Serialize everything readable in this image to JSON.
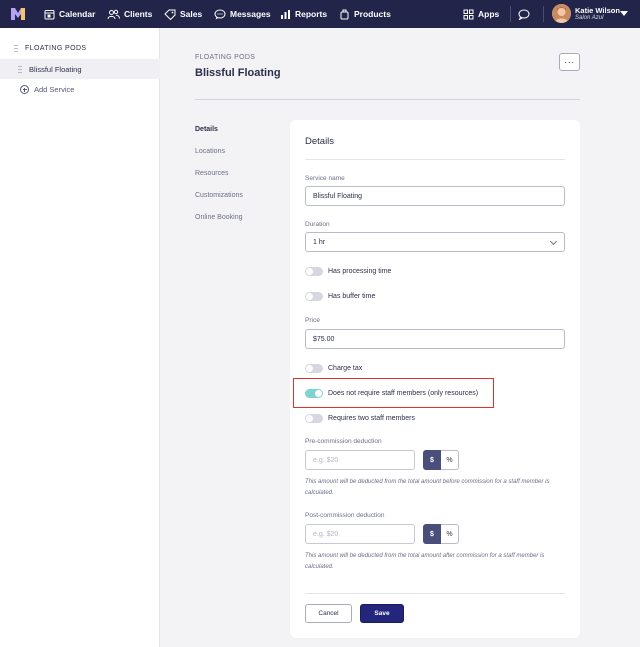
{
  "nav": {
    "items": [
      {
        "label": "Calendar",
        "icon": "calendar-icon"
      },
      {
        "label": "Clients",
        "icon": "clients-icon"
      },
      {
        "label": "Sales",
        "icon": "tag-icon"
      },
      {
        "label": "Messages",
        "icon": "messages-icon"
      },
      {
        "label": "Reports",
        "icon": "reports-icon"
      },
      {
        "label": "Products",
        "icon": "products-icon"
      }
    ],
    "apps_label": "Apps",
    "user_name": "Katie Wilson",
    "user_location": "Salon Azul",
    "bg_color": "#22244a"
  },
  "sidebar": {
    "heading": "FLOATING PODS",
    "active_item": "Blissful Floating",
    "add_label": "Add Service"
  },
  "header": {
    "breadcrumb": "FLOATING PODS",
    "title": "Blissful Floating",
    "more_label": "···"
  },
  "sections": [
    "Details",
    "Locations",
    "Resources",
    "Customizations",
    "Online Booking"
  ],
  "form": {
    "title": "Details",
    "service_name_label": "Service name",
    "service_name_value": "Blissful Floating",
    "duration_label": "Duration",
    "duration_value": "1 hr",
    "toggles_a": [
      {
        "label": "Has processing time",
        "on": false
      },
      {
        "label": "Has buffer time",
        "on": false
      }
    ],
    "price_label": "Price",
    "price_value": "$75.00",
    "toggles_b": [
      {
        "label": "Charge tax",
        "on": false
      },
      {
        "label": "Does not require staff members (only resources)",
        "on": true
      },
      {
        "label": "Requires two staff members",
        "on": false
      }
    ],
    "pre_commission_label": "Pre-commission deduction",
    "pre_commission_placeholder": "e.g. $20",
    "pre_commission_hint": "This amount will be deducted from the total amount before commission for a staff member is calculated.",
    "post_commission_label": "Post-commission deduction",
    "post_commission_placeholder": "e.g. $20",
    "post_commission_hint": "This amount will be deducted from the total amount after commission for a staff member is calculated.",
    "dollar_label": "$",
    "percent_label": "%",
    "cancel_label": "Cancel",
    "save_label": "Save",
    "accent_color": "#23267a",
    "toggle_on_color": "#7fd3d0",
    "highlight_color": "#e0312c"
  }
}
